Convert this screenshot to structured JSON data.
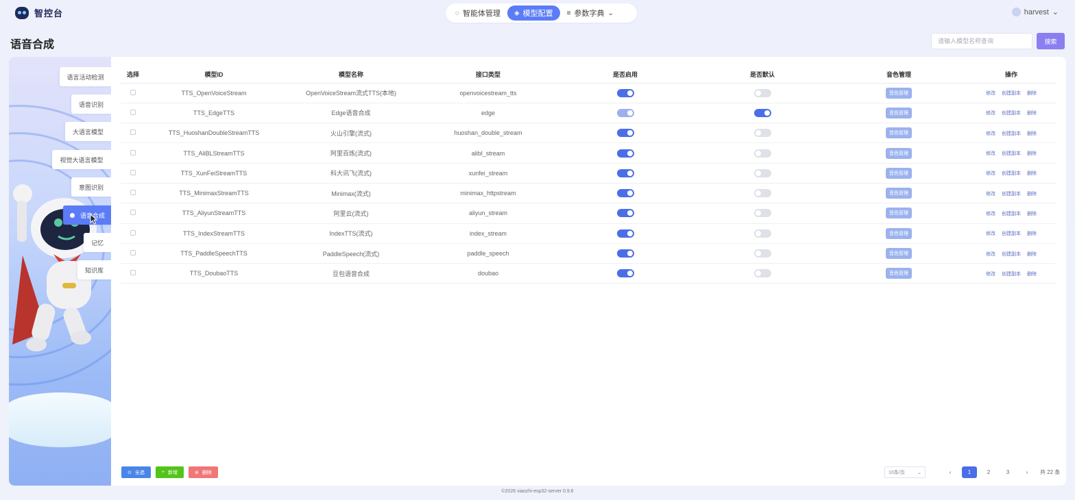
{
  "app": {
    "logo_text": "智控台"
  },
  "nav": {
    "items": [
      {
        "label": "智能体管理",
        "icon": "agent-icon"
      },
      {
        "label": "模型配置",
        "icon": "model-icon"
      },
      {
        "label": "参数字典",
        "icon": "dictionary-icon"
      }
    ],
    "active": "模型配置"
  },
  "user": {
    "name": "harvest"
  },
  "page": {
    "title": "语音合成"
  },
  "search": {
    "placeholder": "请输入模型名称查询",
    "button_label": "搜索"
  },
  "sidebar": {
    "items": [
      {
        "label": "语言活动检测"
      },
      {
        "label": "语音识别"
      },
      {
        "label": "大语言模型"
      },
      {
        "label": "视觉大语言模型"
      },
      {
        "label": "意图识别"
      },
      {
        "label": "语音合成"
      },
      {
        "label": "记忆"
      },
      {
        "label": "知识库"
      }
    ],
    "active": "语音合成"
  },
  "table": {
    "headers": {
      "select": "选择",
      "model_id": "模型ID",
      "model_name": "模型名称",
      "api_type": "接口类型",
      "enabled": "是否启用",
      "default": "是否默认",
      "voice": "音色管理",
      "ops": "操作"
    },
    "voice_button_label": "音色管理",
    "op_labels": {
      "edit": "修改",
      "copy": "创建副本",
      "delete": "删除"
    },
    "rows": [
      {
        "id": "TTS_OpenVoiceStream",
        "name": "OpenVoiceStream流式TTS(本地)",
        "type": "openvoicestream_tts",
        "enabled": true,
        "default": false
      },
      {
        "id": "TTS_EdgeTTS",
        "name": "Edge语音合成",
        "type": "edge",
        "enabled": true,
        "default": true
      },
      {
        "id": "TTS_HuoshanDoubleStreamTTS",
        "name": "火山引擎(流式)",
        "type": "huoshan_double_stream",
        "enabled": true,
        "default": false
      },
      {
        "id": "TTS_AliBLStreamTTS",
        "name": "阿里百炼(流式)",
        "type": "alibl_stream",
        "enabled": true,
        "default": false
      },
      {
        "id": "TTS_XunFeiStreamTTS",
        "name": "科大讯飞(流式)",
        "type": "xunfei_stream",
        "enabled": true,
        "default": false
      },
      {
        "id": "TTS_MinimaxStreamTTS",
        "name": "Minimax(流式)",
        "type": "minimax_httpstream",
        "enabled": true,
        "default": false
      },
      {
        "id": "TTS_AliyunStreamTTS",
        "name": "阿里云(流式)",
        "type": "aliyun_stream",
        "enabled": true,
        "default": false
      },
      {
        "id": "TTS_IndexStreamTTS",
        "name": "IndexTTS(流式)",
        "type": "index_stream",
        "enabled": true,
        "default": false
      },
      {
        "id": "TTS_PaddleSpeechTTS",
        "name": "PaddleSpeech(流式)",
        "type": "paddle_speech",
        "enabled": true,
        "default": false
      },
      {
        "id": "TTS_DoubaoTTS",
        "name": "豆包语音合成",
        "type": "doubao",
        "enabled": true,
        "default": false
      }
    ]
  },
  "actions": {
    "select_all": "全选",
    "add": "新增",
    "delete": "删除"
  },
  "pagination": {
    "page_size": "10条/页",
    "pages": [
      "1",
      "2",
      "3"
    ],
    "current": "1",
    "total": "共 22 条"
  },
  "footer": {
    "copyright": "©2026 xiaozhi-esp32-server 0.9.6"
  },
  "colors": {
    "accent": "#5b7cf6",
    "switch_on": "#4b6ee8",
    "add": "#52c41a",
    "delete": "#f07677",
    "search": "#8a7ef0"
  }
}
